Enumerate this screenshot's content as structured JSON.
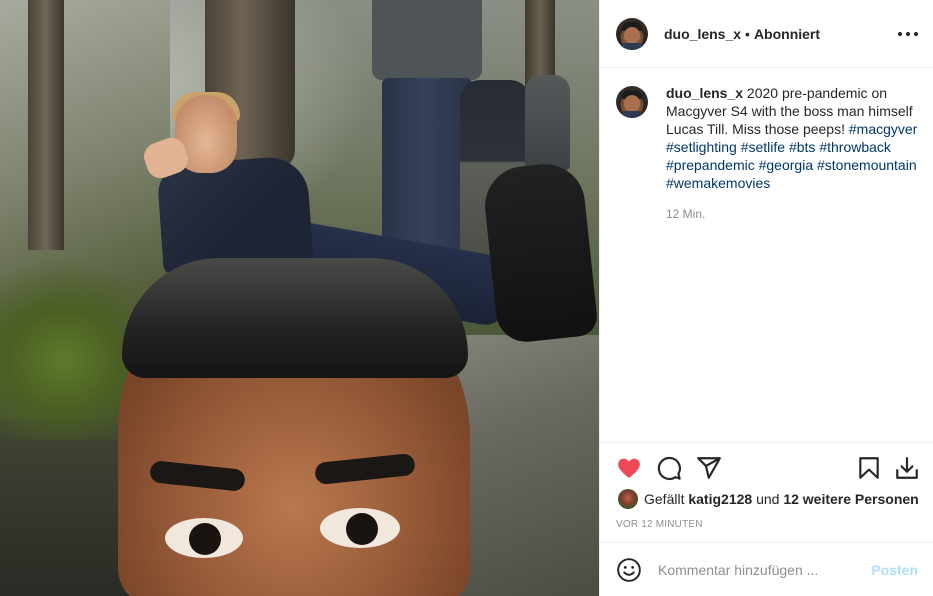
{
  "post": {
    "author": {
      "username": "duo_lens_x",
      "separator": "•",
      "follow_status": "Abonniert"
    },
    "photo": {
      "description_icon": "selfie-photo"
    },
    "caption": {
      "username": "duo_lens_x",
      "text": "2020 pre-pandemic on Macgyver S4 with the boss man himself Lucas Till. Miss those peeps!",
      "hashtags": "#macgyver #setlighting #setlife #bts #throwback #prepandemic #georgia #stonemountain #wemakemovies",
      "time_ago": "12 Min."
    },
    "actions": {
      "like_icon": "heart-filled-icon",
      "like_color": "#ed4956",
      "comment_icon": "comment-icon",
      "share_icon": "share-icon",
      "save_icon": "bookmark-icon",
      "download_icon": "download-icon"
    },
    "likes": {
      "prefix": "Gefällt",
      "user": "katig2128",
      "connector": "und",
      "others": "12 weitere Personen"
    },
    "posted_ago": "VOR 12 MINUTEN",
    "comment_box": {
      "placeholder": "Kommentar hinzufügen ...",
      "post_label": "Posten",
      "emoji_icon": "emoji-icon"
    },
    "colors": {
      "link": "#00376b",
      "muted": "#8e8e8e",
      "post_disabled": "#b2dffc"
    }
  }
}
